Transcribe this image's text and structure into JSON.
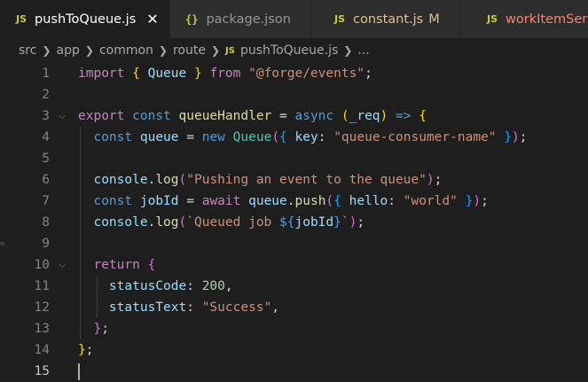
{
  "tabs": [
    {
      "icon": "JS",
      "label": "pushToQueue.js",
      "close": "✕",
      "active": true,
      "modifier": ""
    },
    {
      "icon": "{}",
      "label": "package.json",
      "close": "",
      "active": false,
      "modifier": ""
    },
    {
      "icon": "JS",
      "label": "constant.js",
      "close": "",
      "active": false,
      "modifier": "M"
    },
    {
      "icon": "JS",
      "label": "workItemSer",
      "close": "",
      "active": false,
      "modifier": ""
    }
  ],
  "breadcrumb": {
    "parts": [
      "src",
      "app",
      "common",
      "route"
    ],
    "file_icon": "JS",
    "file": "pushToQueue.js",
    "tail": "..."
  },
  "colors": {
    "keyword": "#c586c0",
    "storage": "#569cd6",
    "variable": "#9cdcfe",
    "function": "#dcdcaa",
    "type": "#4ec9b0",
    "string": "#ce9178",
    "number": "#b5cea8",
    "bracket1": "#ffd700",
    "bracket2": "#da70d6",
    "bracket3": "#179fff",
    "text": "#d4d4d4"
  },
  "lines": [
    {
      "n": "1",
      "fold": "",
      "tokens": [
        [
          "import",
          "keyword"
        ],
        [
          " ",
          "text"
        ],
        [
          "{",
          "bracket1"
        ],
        [
          " ",
          "text"
        ],
        [
          "Queue",
          "variable"
        ],
        [
          " ",
          "text"
        ],
        [
          "}",
          "bracket1"
        ],
        [
          " ",
          "text"
        ],
        [
          "from",
          "keyword"
        ],
        [
          " ",
          "text"
        ],
        [
          "\"@forge/events\"",
          "string"
        ],
        [
          ";",
          "text"
        ]
      ]
    },
    {
      "n": "2",
      "fold": "",
      "tokens": []
    },
    {
      "n": "3",
      "fold": "⌵",
      "tokens": [
        [
          "export",
          "keyword"
        ],
        [
          " ",
          "text"
        ],
        [
          "const",
          "storage"
        ],
        [
          " ",
          "text"
        ],
        [
          "queueHandler",
          "function"
        ],
        [
          " = ",
          "text"
        ],
        [
          "async",
          "storage"
        ],
        [
          " ",
          "text"
        ],
        [
          "(",
          "bracket1"
        ],
        [
          "_req",
          "variable"
        ],
        [
          ")",
          "bracket1"
        ],
        [
          " ",
          "text"
        ],
        [
          "=>",
          "storage"
        ],
        [
          " ",
          "text"
        ],
        [
          "{",
          "bracket1"
        ]
      ]
    },
    {
      "n": "4",
      "fold": "",
      "tokens": [
        [
          "  ",
          "text"
        ],
        [
          "const",
          "storage"
        ],
        [
          " ",
          "text"
        ],
        [
          "queue",
          "variable"
        ],
        [
          " = ",
          "text"
        ],
        [
          "new",
          "storage"
        ],
        [
          " ",
          "text"
        ],
        [
          "Queue",
          "type"
        ],
        [
          "(",
          "bracket2"
        ],
        [
          "{",
          "bracket3"
        ],
        [
          " ",
          "text"
        ],
        [
          "key",
          "variable"
        ],
        [
          ": ",
          "text"
        ],
        [
          "\"queue-consumer-name\"",
          "string"
        ],
        [
          " ",
          "text"
        ],
        [
          "}",
          "bracket3"
        ],
        [
          ")",
          "bracket2"
        ],
        [
          ";",
          "text"
        ]
      ]
    },
    {
      "n": "5",
      "fold": "",
      "tokens": []
    },
    {
      "n": "6",
      "fold": "",
      "tokens": [
        [
          "  ",
          "text"
        ],
        [
          "console",
          "variable"
        ],
        [
          ".",
          "text"
        ],
        [
          "log",
          "function"
        ],
        [
          "(",
          "bracket2"
        ],
        [
          "\"Pushing an event to the queue\"",
          "string"
        ],
        [
          ")",
          "bracket2"
        ],
        [
          ";",
          "text"
        ]
      ]
    },
    {
      "n": "7",
      "fold": "",
      "tokens": [
        [
          "  ",
          "text"
        ],
        [
          "const",
          "storage"
        ],
        [
          " ",
          "text"
        ],
        [
          "jobId",
          "variable"
        ],
        [
          " = ",
          "text"
        ],
        [
          "await",
          "keyword"
        ],
        [
          " ",
          "text"
        ],
        [
          "queue",
          "variable"
        ],
        [
          ".",
          "text"
        ],
        [
          "push",
          "function"
        ],
        [
          "(",
          "bracket2"
        ],
        [
          "{",
          "bracket3"
        ],
        [
          " ",
          "text"
        ],
        [
          "hello",
          "variable"
        ],
        [
          ": ",
          "text"
        ],
        [
          "\"world\"",
          "string"
        ],
        [
          " ",
          "text"
        ],
        [
          "}",
          "bracket3"
        ],
        [
          ")",
          "bracket2"
        ],
        [
          ";",
          "text"
        ]
      ]
    },
    {
      "n": "8",
      "fold": "",
      "tokens": [
        [
          "  ",
          "text"
        ],
        [
          "console",
          "variable"
        ],
        [
          ".",
          "text"
        ],
        [
          "log",
          "function"
        ],
        [
          "(",
          "bracket2"
        ],
        [
          "`Queued job ",
          "string"
        ],
        [
          "${",
          "storage"
        ],
        [
          "jobId",
          "variable"
        ],
        [
          "}",
          "storage"
        ],
        [
          "`",
          "string"
        ],
        [
          ")",
          "bracket2"
        ],
        [
          ";",
          "text"
        ]
      ]
    },
    {
      "n": "9",
      "fold": "",
      "tokens": []
    },
    {
      "n": "10",
      "fold": "⌵",
      "tokens": [
        [
          "  ",
          "text"
        ],
        [
          "return",
          "keyword"
        ],
        [
          " ",
          "text"
        ],
        [
          "{",
          "bracket2"
        ]
      ]
    },
    {
      "n": "11",
      "fold": "",
      "tokens": [
        [
          "    ",
          "text"
        ],
        [
          "statusCode",
          "variable"
        ],
        [
          ": ",
          "text"
        ],
        [
          "200",
          "number"
        ],
        [
          ",",
          "text"
        ]
      ]
    },
    {
      "n": "12",
      "fold": "",
      "tokens": [
        [
          "    ",
          "text"
        ],
        [
          "statusText",
          "variable"
        ],
        [
          ": ",
          "text"
        ],
        [
          "\"Success\"",
          "string"
        ],
        [
          ",",
          "text"
        ]
      ]
    },
    {
      "n": "13",
      "fold": "",
      "tokens": [
        [
          "  ",
          "text"
        ],
        [
          "}",
          "bracket2"
        ],
        [
          ";",
          "text"
        ]
      ]
    },
    {
      "n": "14",
      "fold": "",
      "tokens": [
        [
          "}",
          "bracket1"
        ],
        [
          ";",
          "text"
        ]
      ]
    },
    {
      "n": "15",
      "fold": "",
      "tokens": []
    }
  ],
  "current_line": "15"
}
